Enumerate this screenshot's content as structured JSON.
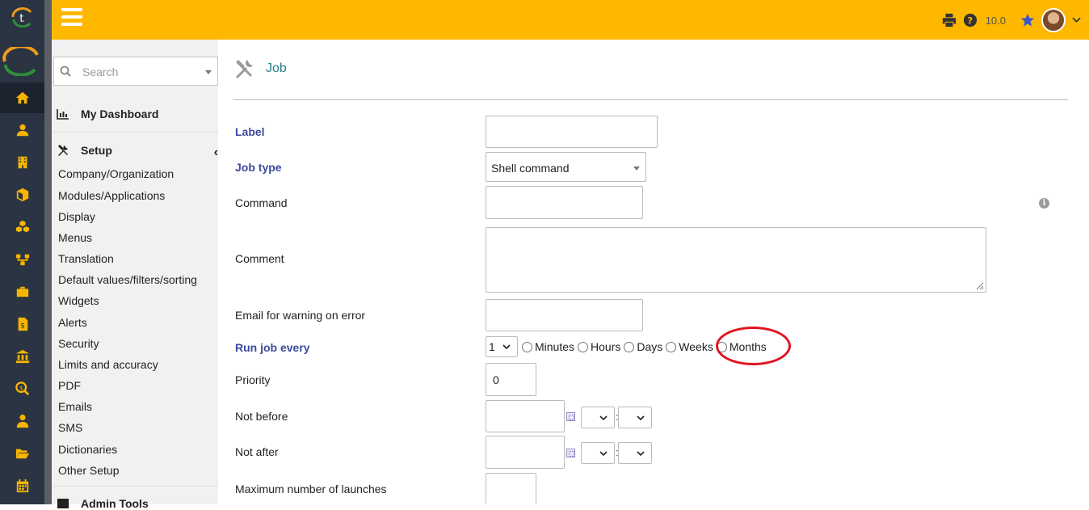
{
  "topbar": {
    "version": "10.0"
  },
  "search": {
    "placeholder": "Search"
  },
  "menu": {
    "dashboard": "My Dashboard",
    "setup": "Setup",
    "collapse": "‹",
    "items": [
      "Company/Organization",
      "Modules/Applications",
      "Display",
      "Menus",
      "Translation",
      "Default values/filters/sorting",
      "Widgets",
      "Alerts",
      "Security",
      "Limits and accuracy",
      "PDF",
      "Emails",
      "SMS",
      "Dictionaries",
      "Other Setup"
    ],
    "admin_tools": "Admin Tools"
  },
  "page": {
    "title": "Job"
  },
  "form": {
    "label": "Label",
    "job_type": "Job type",
    "job_type_value": "Shell command",
    "command": "Command",
    "comment": "Comment",
    "email_warning": "Email for warning on error",
    "run_job_every": "Run job every",
    "run_every_value": "1",
    "units": [
      "Minutes",
      "Hours",
      "Days",
      "Weeks",
      "Months"
    ],
    "priority": "Priority",
    "priority_value": "0",
    "not_before": "Not before",
    "not_after": "Not after",
    "max_launches": "Maximum number of launches",
    "colon": ":"
  },
  "colors": {
    "topbar": "#ffb800",
    "rail": "#2b3442",
    "accent_icon": "#f7b500",
    "required_label": "#3c4a9c",
    "highlight": "#e0141e"
  },
  "highlighted_option": "Months"
}
